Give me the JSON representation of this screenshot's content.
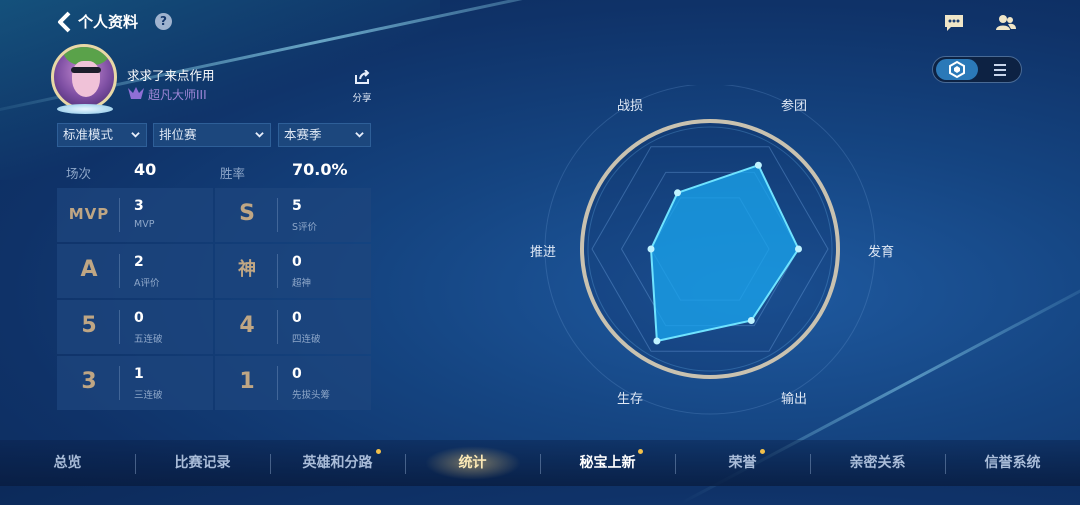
{
  "header": {
    "title": "个人资料",
    "help_glyph": "?"
  },
  "profile": {
    "username": "求求了来点作用",
    "rank": "超凡大师III",
    "share_label": "分享"
  },
  "filters": [
    {
      "label": "标准模式"
    },
    {
      "label": "排位赛"
    },
    {
      "label": "本赛季"
    }
  ],
  "overview": {
    "matches_label": "场次",
    "matches_value": "40",
    "winrate_label": "胜率",
    "winrate_value": "70.0%"
  },
  "stats": [
    {
      "glyph": "MVP",
      "value": "3",
      "label": "MVP"
    },
    {
      "glyph": "S",
      "value": "5",
      "label": "S评价"
    },
    {
      "glyph": "A",
      "value": "2",
      "label": "A评价"
    },
    {
      "glyph": "神",
      "value": "0",
      "label": "超神"
    },
    {
      "glyph": "5",
      "value": "0",
      "label": "五连破"
    },
    {
      "glyph": "4",
      "value": "0",
      "label": "四连破"
    },
    {
      "glyph": "3",
      "value": "1",
      "label": "三连破"
    },
    {
      "glyph": "1",
      "value": "0",
      "label": "先拔头筹"
    }
  ],
  "radar": {
    "axes": [
      "战损",
      "参团",
      "发育",
      "输出",
      "生存",
      "推进"
    ],
    "values": [
      0.55,
      0.82,
      0.75,
      0.7,
      0.9,
      0.5
    ],
    "fill_color": "#1aa7f0",
    "stroke_color": "#6fe3ff"
  },
  "view_toggle": {
    "active": "radar",
    "icons": [
      "hexagon-icon",
      "list-icon"
    ]
  },
  "nav": {
    "items": [
      {
        "label": "总览",
        "dot": false
      },
      {
        "label": "比赛记录",
        "dot": false
      },
      {
        "label": "英雄和分路",
        "dot": true
      },
      {
        "label": "统计",
        "dot": false,
        "active": true
      },
      {
        "label": "秘宝上新",
        "dot": true
      },
      {
        "label": "荣誉",
        "dot": true
      },
      {
        "label": "亲密关系",
        "dot": false
      },
      {
        "label": "信誉系统",
        "dot": false
      }
    ]
  },
  "colors": {
    "accent": "#2b79b8",
    "active_nav": "#fbe9b6",
    "stat_glyph": "#bfa684"
  }
}
